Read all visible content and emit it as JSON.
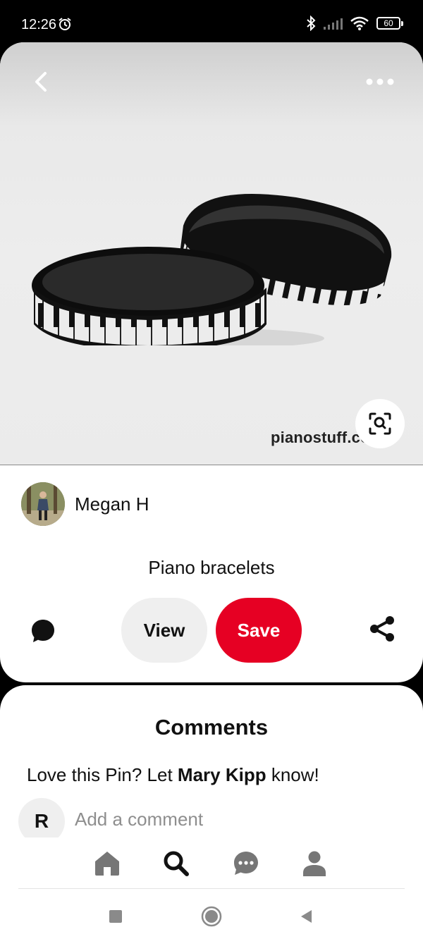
{
  "status_bar": {
    "time": "12:26",
    "battery_level": "60",
    "icons": [
      "alarm-icon",
      "bluetooth-icon",
      "signal-icon",
      "wifi-icon",
      "battery-icon"
    ]
  },
  "pin": {
    "image_description_icons": [
      "back-chevron-icon",
      "more-dots-icon",
      "visual-search-icon"
    ],
    "watermark": "pianostuff.com",
    "author_name": "Megan H",
    "title": "Piano bracelets",
    "view_label": "View",
    "save_label": "Save",
    "accent_color": "#e60023"
  },
  "comments": {
    "heading": "Comments",
    "prompt_prefix": "Love this Pin? Let ",
    "prompt_name": "Mary Kipp",
    "prompt_suffix": " know!",
    "user_initial": "R",
    "placeholder": "Add a comment"
  },
  "tab_bar": {
    "tabs": [
      "home-icon",
      "search-icon",
      "messages-icon",
      "profile-icon"
    ]
  },
  "system_nav": [
    "recents-icon",
    "home-circle-icon",
    "back-triangle-icon"
  ]
}
